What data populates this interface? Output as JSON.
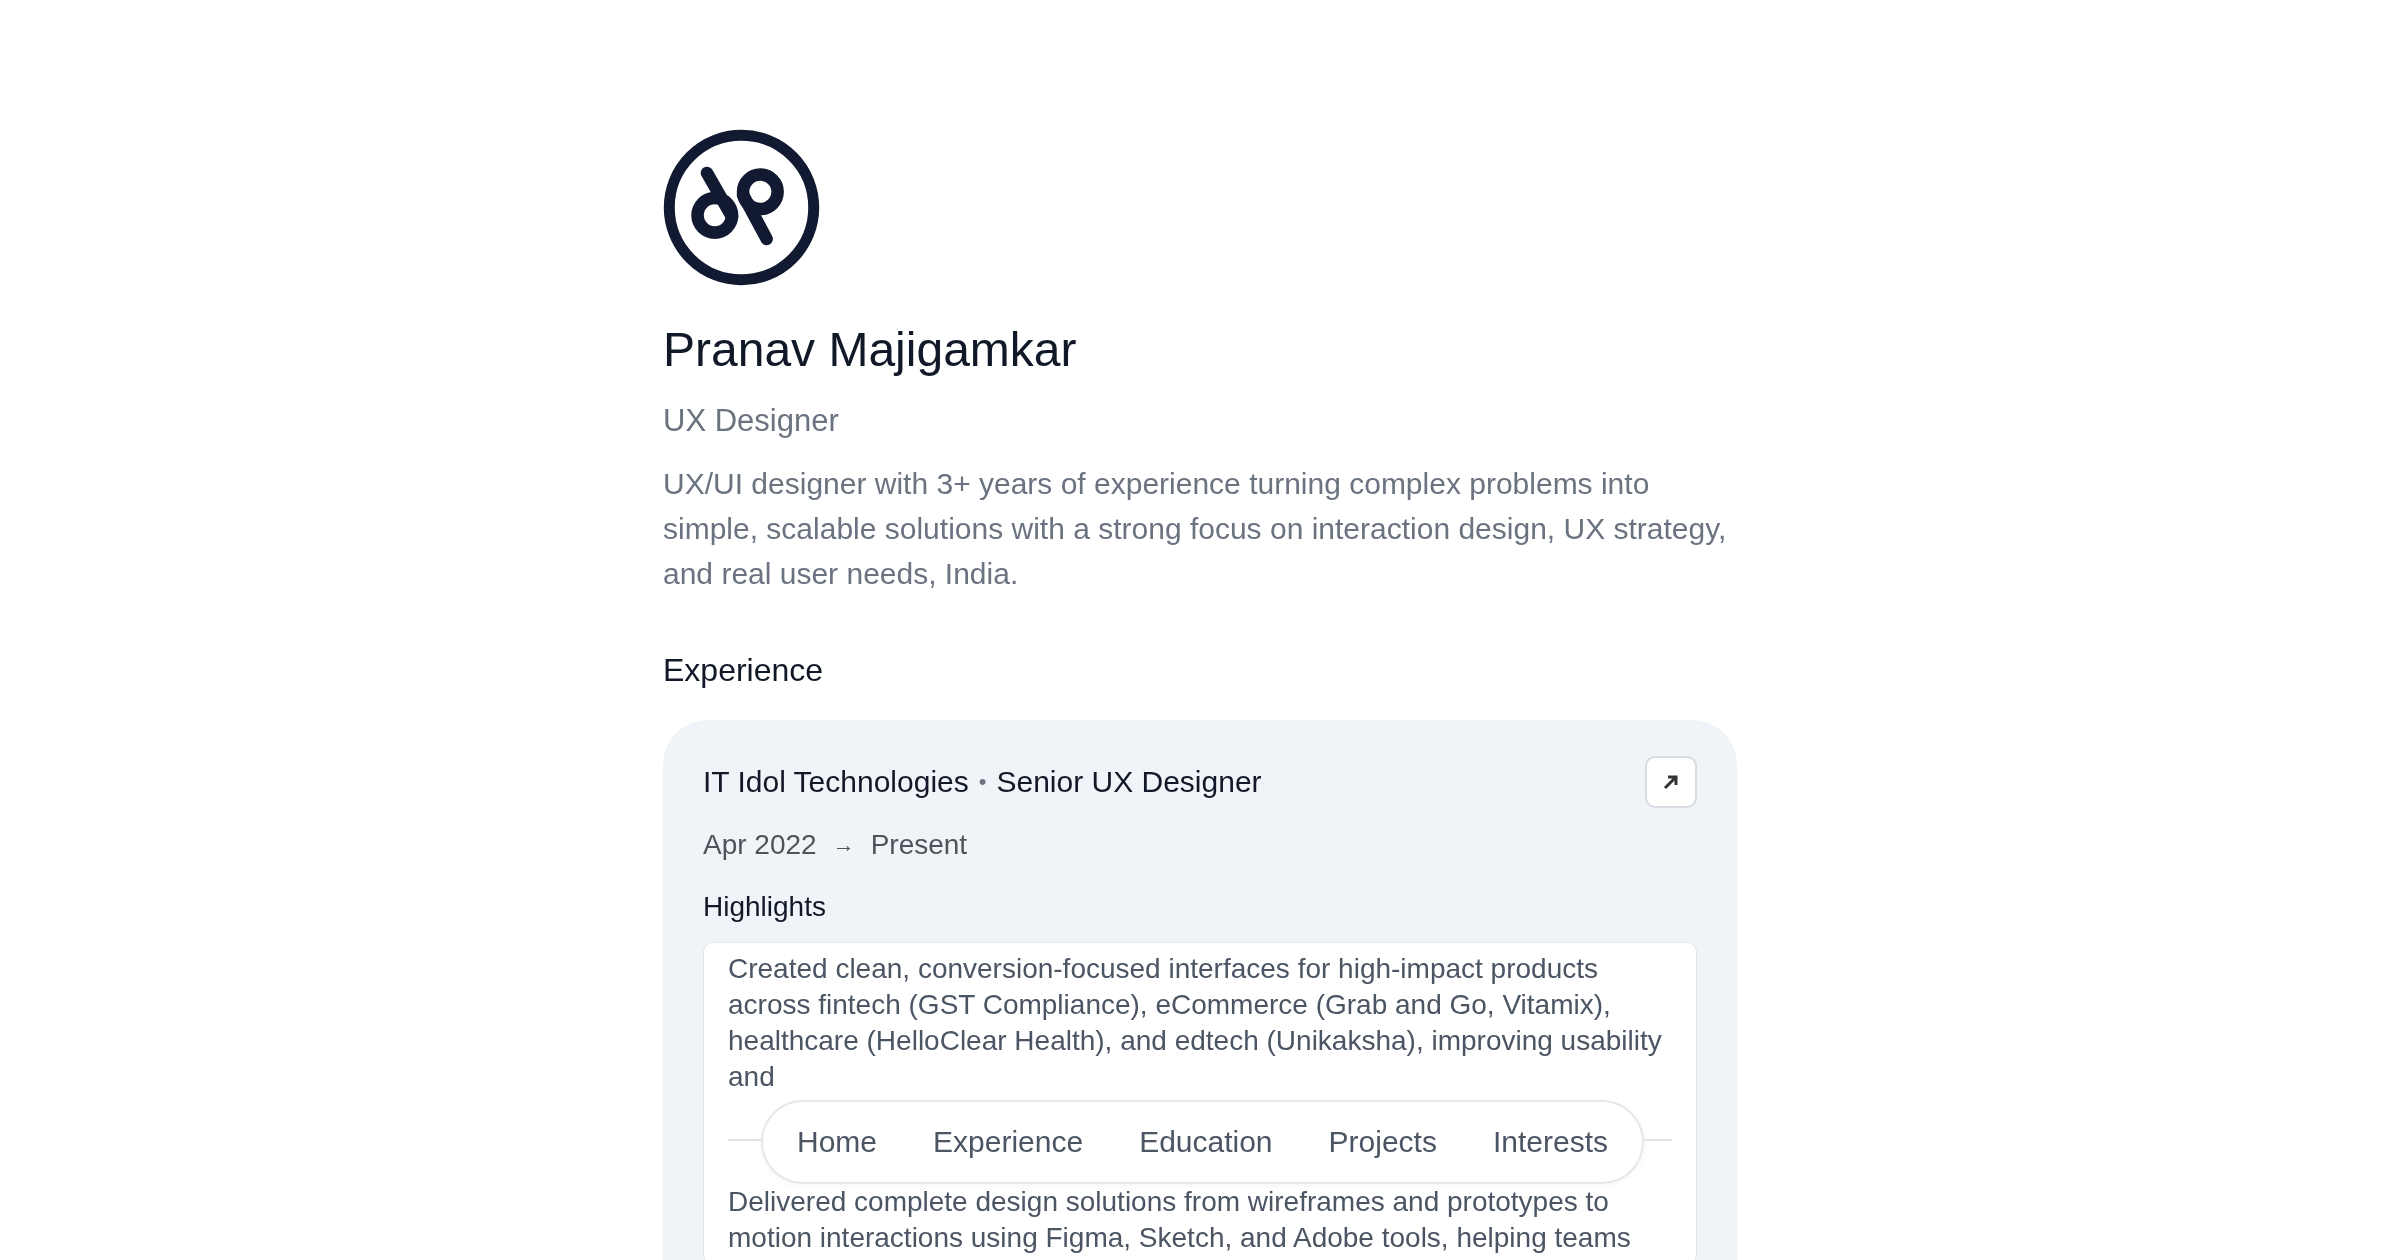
{
  "profile": {
    "name": "Pranav Majigamkar",
    "role": "UX Designer",
    "bio": "UX/UI designer with 3+ years of experience turning complex problems into simple, scalable solutions with a strong focus on interaction design, UX strategy, and real user needs, India."
  },
  "experience": {
    "heading": "Experience",
    "items": [
      {
        "company": "IT Idol Technologies",
        "separator": "•",
        "title": "Senior UX Designer",
        "start": "Apr 2022",
        "arrow": "→",
        "end": "Present",
        "highlights_heading": "Highlights",
        "highlights": [
          "Created clean, conversion-focused interfaces for high-impact products across fintech (GST Compliance), eCommerce (Grab and Go, Vitamix), healthcare (HelloClear Health), and edtech (Unikaksha), improving usability and",
          "Delivered complete design solutions from wireframes and prototypes to motion interactions using Figma, Sketch, and Adobe tools, helping teams"
        ]
      }
    ]
  },
  "nav": {
    "items": [
      "Home",
      "Experience",
      "Education",
      "Projects",
      "Interests"
    ]
  }
}
